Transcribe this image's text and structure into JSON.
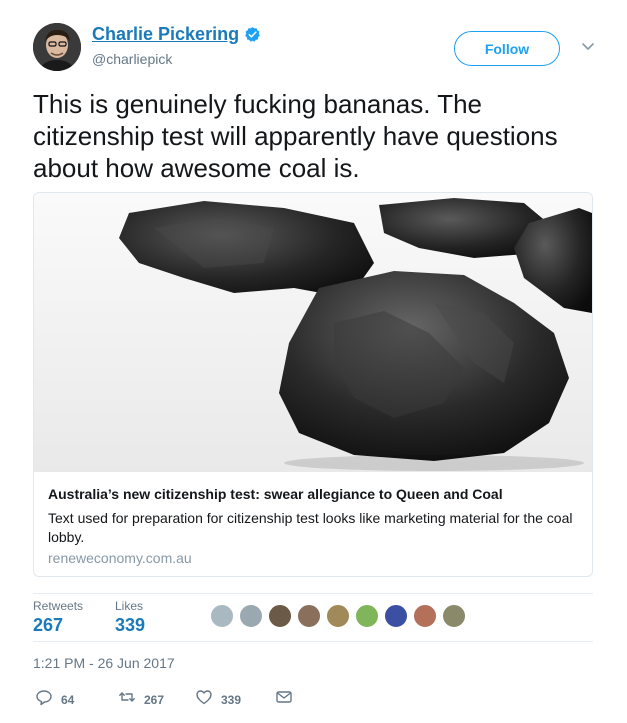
{
  "author": {
    "name": "Charlie Pickering",
    "handle": "@charliepick"
  },
  "follow_label": "Follow",
  "tweet_text": "This is genuinely fucking bananas. The citizenship test will apparently have questions about how awesome coal is.",
  "card": {
    "title": "Australia’s new citizenship test: swear allegiance to Queen and Coal",
    "description": "Text used for preparation for citizenship test looks like marketing material for the coal lobby.",
    "domain": "reneweconomy.com.au"
  },
  "stats": {
    "retweets_label": "Retweets",
    "retweets_value": "267",
    "likes_label": "Likes",
    "likes_value": "339"
  },
  "timestamp": "1:21 PM - 26 Jun 2017",
  "actions": {
    "reply_count": "64",
    "retweet_count": "267",
    "like_count": "339"
  },
  "colors": {
    "link_blue": "#1b7ab9",
    "follow_blue": "#1da1f2",
    "muted_gray": "#657786"
  }
}
